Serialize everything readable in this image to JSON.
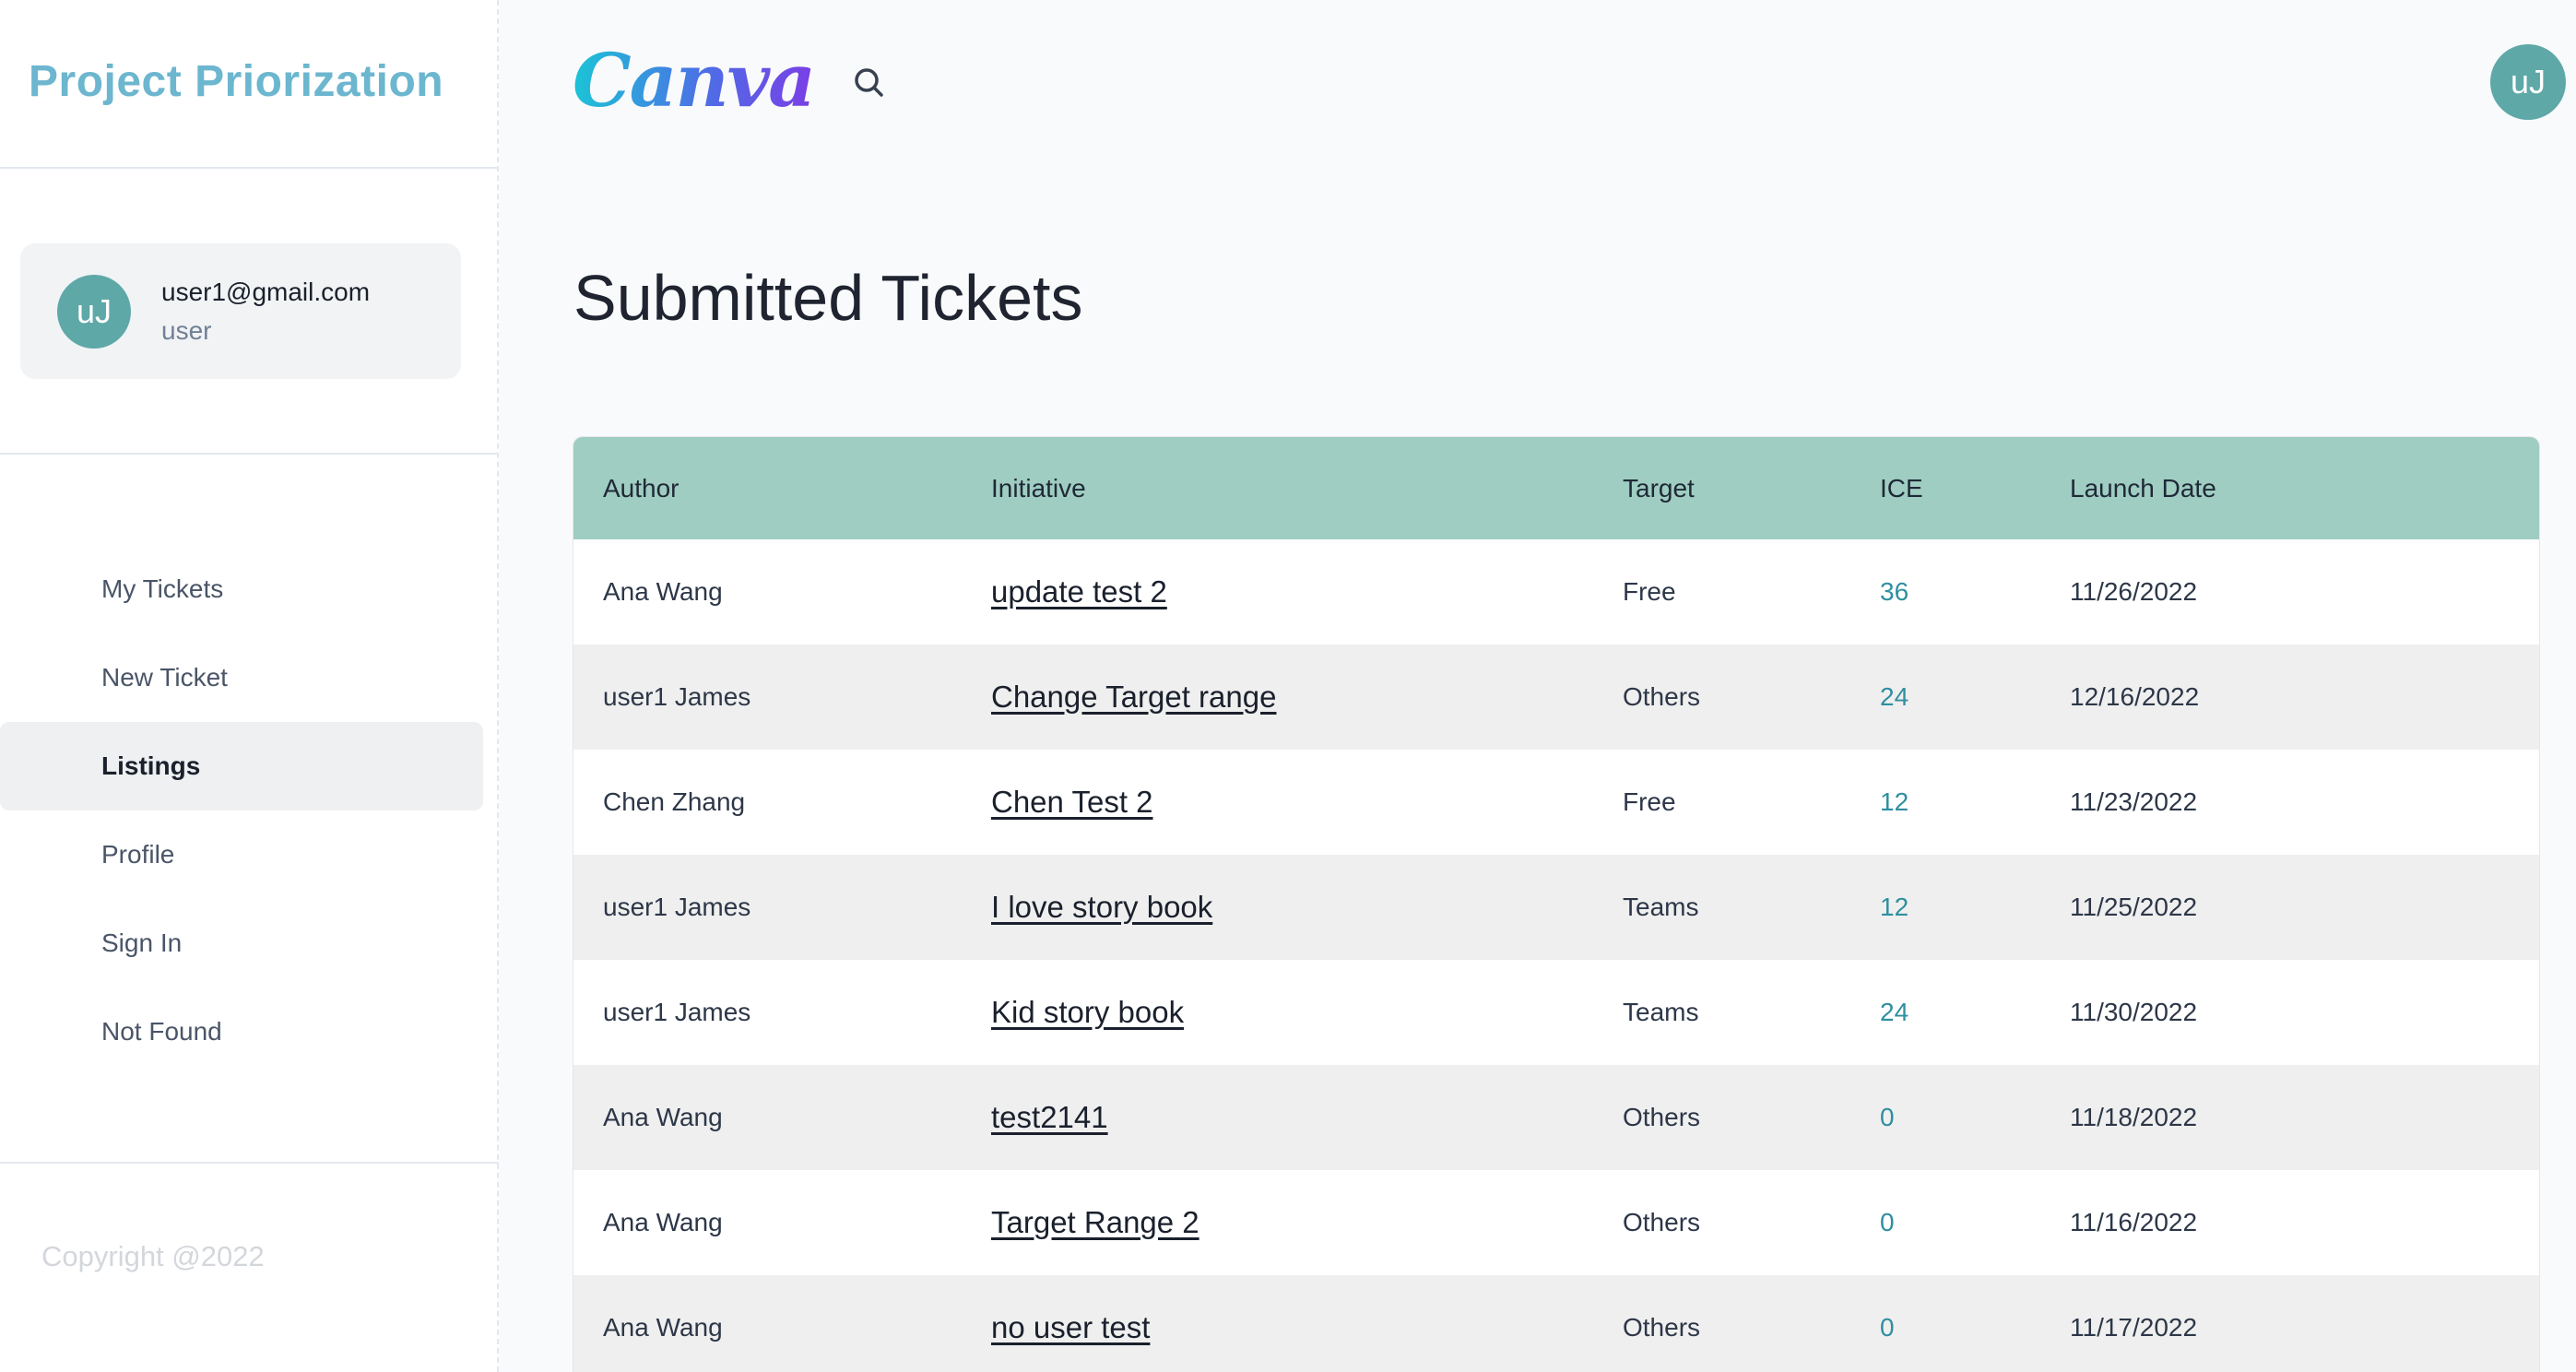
{
  "sidebar": {
    "brand_title": "Project Priorization",
    "user": {
      "initials": "uJ",
      "email": "user1@gmail.com",
      "role": "user"
    },
    "nav": [
      {
        "label": "My Tickets",
        "active": false
      },
      {
        "label": "New Ticket",
        "active": false
      },
      {
        "label": "Listings",
        "active": true
      },
      {
        "label": "Profile",
        "active": false
      },
      {
        "label": "Sign In",
        "active": false
      },
      {
        "label": "Not Found",
        "active": false
      }
    ],
    "copyright": "Copyright @2022"
  },
  "header": {
    "logo_text": "Canva",
    "search_icon": "search-icon",
    "avatar_initials": "uJ"
  },
  "main": {
    "title": "Submitted Tickets",
    "table": {
      "columns": [
        "Author",
        "Initiative",
        "Target",
        "ICE",
        "Launch Date"
      ],
      "rows": [
        {
          "author": "Ana Wang",
          "initiative": "update test 2",
          "target": "Free",
          "ice": "36",
          "launch_date": "11/26/2022"
        },
        {
          "author": "user1 James",
          "initiative": "Change Target range",
          "target": "Others",
          "ice": "24",
          "launch_date": "12/16/2022"
        },
        {
          "author": "Chen Zhang",
          "initiative": "Chen Test 2",
          "target": "Free",
          "ice": "12",
          "launch_date": "11/23/2022"
        },
        {
          "author": "user1 James",
          "initiative": "I love story book",
          "target": "Teams",
          "ice": "12",
          "launch_date": "11/25/2022"
        },
        {
          "author": "user1 James",
          "initiative": "Kid story book",
          "target": "Teams",
          "ice": "24",
          "launch_date": "11/30/2022"
        },
        {
          "author": "Ana Wang",
          "initiative": "test2141",
          "target": "Others",
          "ice": "0",
          "launch_date": "11/18/2022"
        },
        {
          "author": "Ana Wang",
          "initiative": "Target Range 2",
          "target": "Others",
          "ice": "0",
          "launch_date": "11/16/2022"
        },
        {
          "author": "Ana Wang",
          "initiative": "no user test",
          "target": "Others",
          "ice": "0",
          "launch_date": "11/17/2022"
        }
      ]
    }
  },
  "colors": {
    "brand": "#6cb6cf",
    "table_header": "#9fcdc1",
    "ice_value": "#2f8fa0",
    "avatar": "#5fa8a8"
  }
}
